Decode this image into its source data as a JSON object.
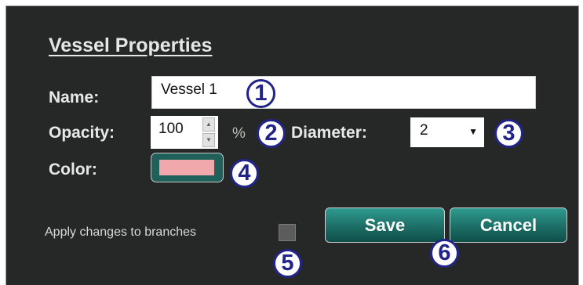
{
  "dialog": {
    "title": "Vessel Properties",
    "name_label": "Name:",
    "name_value": "Vessel 1",
    "opacity_label": "Opacity:",
    "opacity_value": "100",
    "opacity_unit": "%",
    "diameter_label": "Diameter:",
    "diameter_value": "2",
    "color_label": "Color:",
    "color_swatch": "#f0a8ad",
    "apply_label": "Apply changes to branches",
    "apply_checked": false,
    "save_label": "Save",
    "cancel_label": "Cancel"
  },
  "callouts": [
    "1",
    "2",
    "3",
    "4",
    "5",
    "6"
  ]
}
